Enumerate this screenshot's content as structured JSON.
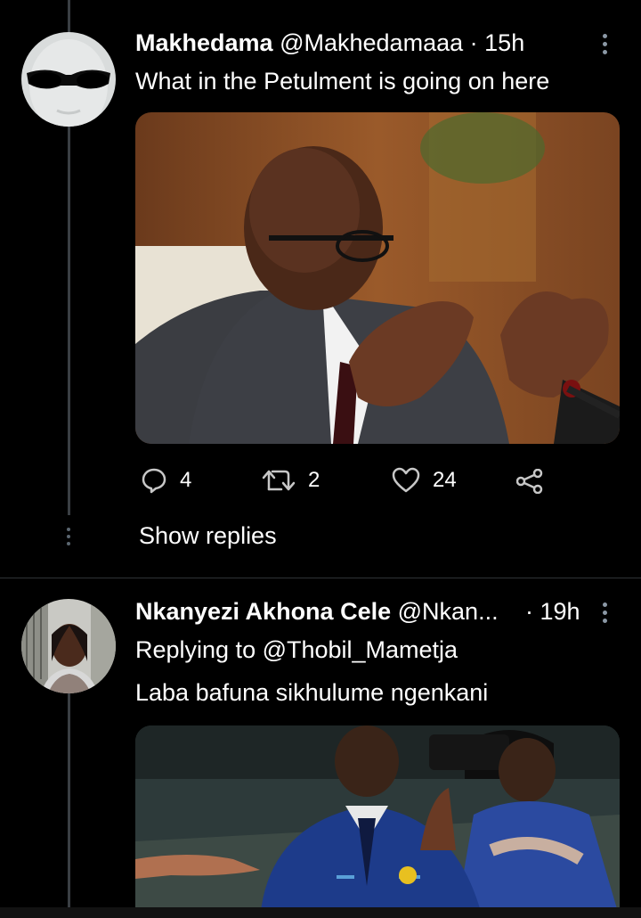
{
  "tweets": [
    {
      "name": "Makhedama",
      "handle": "@Makhedamaaa",
      "separator": "·",
      "time": "15h",
      "text": "What in the Petulment is going on here",
      "media_icon": "photo-man-glasses-gesturing",
      "actions": {
        "replies": "4",
        "retweets": "2",
        "likes": "24"
      }
    },
    {
      "name": "Nkanyezi Akhona Cele",
      "handle": "@Nkan...",
      "separator": "·",
      "time": "19h",
      "replying_to": "Replying to @Thobil_Mametja",
      "text": "Laba bafuna sikhulume ngenkani",
      "media_icon": "photo-coach-raising-hands"
    }
  ],
  "show_replies": "Show replies",
  "colors": {
    "background": "#000000",
    "thread_line": "#3a3f44",
    "divider": "#2f3336",
    "icon_gray": "#8b98a5"
  }
}
